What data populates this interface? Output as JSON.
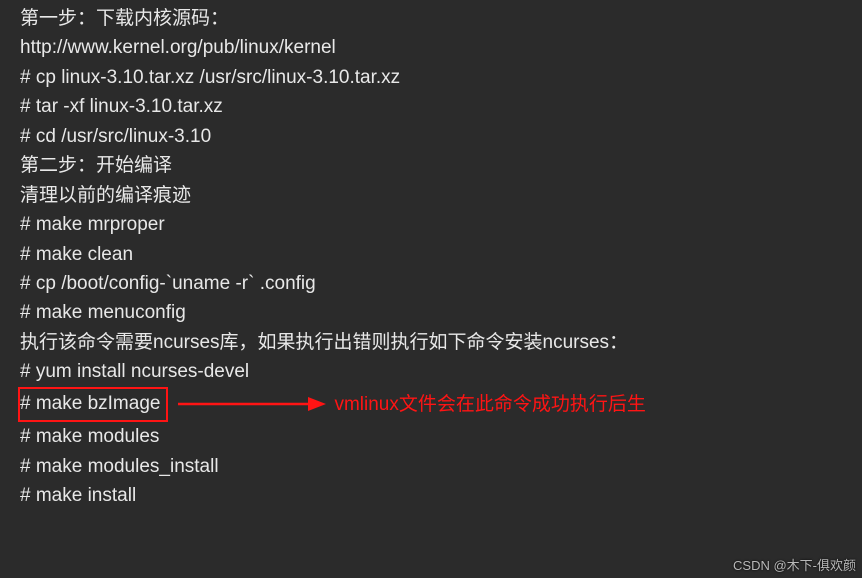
{
  "lines": {
    "l1": "第一步：下载内核源码：",
    "l2": "http://www.kernel.org/pub/linux/kernel",
    "l3": "# cp linux-3.10.tar.xz /usr/src/linux-3.10.tar.xz",
    "l4": "# tar -xf linux-3.10.tar.xz",
    "l5": "# cd /usr/src/linux-3.10",
    "l6": "第二步：开始编译",
    "l7": "清理以前的编译痕迹",
    "l8": "# make mrproper",
    "l9": "# make clean",
    "l10": "# cp /boot/config-`uname -r` .config",
    "l11": "# make menuconfig",
    "l12": "执行该命令需要ncurses库，如果执行出错则执行如下命令安装ncurses：",
    "l13": "# yum install ncurses-devel",
    "l14": "# make bzImage",
    "l15": "# make modules",
    "l16": "# make modules_install",
    "l17": "# make install"
  },
  "annotation": "vmlinux文件会在此命令成功执行后生",
  "watermark": "CSDN @木下-俱欢颜"
}
